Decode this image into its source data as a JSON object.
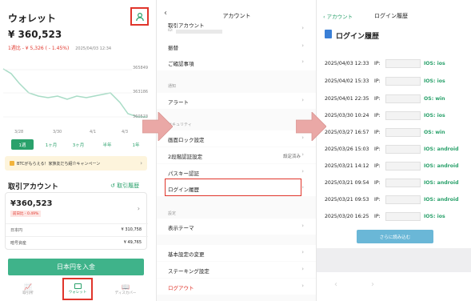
{
  "wallet": {
    "title": "ウォレット",
    "total": "¥ 360,523",
    "change": "1週比 - ¥ 5,326 ( - 1.45%)",
    "timestamp": "2025/04/03 12:34",
    "chart_labels": [
      "365849",
      "363186",
      "360523"
    ],
    "x_ticks": [
      "3/28",
      "3/30",
      "4/1",
      "4/3"
    ],
    "periods": [
      "1週",
      "1ヶ月",
      "3ヶ月",
      "半年",
      "1年"
    ],
    "promo": "BTCがもらえる！家族友だち紹介キャンペーン",
    "account_heading": "取引アカウント",
    "history_link": "取引履歴",
    "account_amount": "¥360,523",
    "account_badge": "前日比 - 0.49%",
    "rows": [
      {
        "label": "日本円",
        "value": "¥ 310,758"
      },
      {
        "label": "暗号資産",
        "value": "¥ 49,765"
      }
    ],
    "deposit": "日本円を入金",
    "tabs": [
      "取引所",
      "ウォレット",
      "ディスカバー"
    ]
  },
  "account": {
    "title": "アカウント",
    "top_item": "取引アカウント",
    "top_item_id": "ID:",
    "items_group1": [
      "振替",
      "ご確認事項"
    ],
    "section_notify": "通知",
    "alert": "アラート",
    "section_security": "セキュリティ",
    "screen_lock": "画面ロック設定",
    "twofa": "2段階認証設定",
    "twofa_status": "設定済み",
    "passkey": "パスキー認証",
    "login_history": "ログイン履歴",
    "section_settings": "設定",
    "display_theme": "表示テーマ",
    "basic_settings": "基本設定の変更",
    "staking": "ステーキング設定",
    "logout": "ログアウト"
  },
  "history": {
    "back": "アカウント",
    "title": "ログイン履歴",
    "heading": "ログイン履歴",
    "entries": [
      {
        "date": "2025/04/03 12:33",
        "ip": "IP:",
        "os": "IOS: ios"
      },
      {
        "date": "2025/04/02 15:33",
        "ip": "IP:",
        "os": "IOS: ios"
      },
      {
        "date": "2025/04/01 22:35",
        "ip": "IP:",
        "os": "OS: win"
      },
      {
        "date": "2025/03/30 10:24",
        "ip": "IP:",
        "os": "IOS: ios"
      },
      {
        "date": "2025/03/27 16:57",
        "ip": "IP:",
        "os": "OS: win"
      },
      {
        "date": "2025/03/26 15:03",
        "ip": "IP:",
        "os": "IOS: android"
      },
      {
        "date": "2025/03/21 14:12",
        "ip": "IP:",
        "os": "IOS: android"
      },
      {
        "date": "2025/03/21 09:54",
        "ip": "IP:",
        "os": "IOS: android"
      },
      {
        "date": "2025/03/21 09:53",
        "ip": "IP:",
        "os": "IOS: android"
      },
      {
        "date": "2025/03/20 16:25",
        "ip": "IP:",
        "os": "IOS: ios"
      }
    ],
    "load_more": "さらに読み込む"
  },
  "colors": {
    "accent": "#2aa16b",
    "highlight": "#e0352b",
    "arrow": "#e9a6a6"
  }
}
